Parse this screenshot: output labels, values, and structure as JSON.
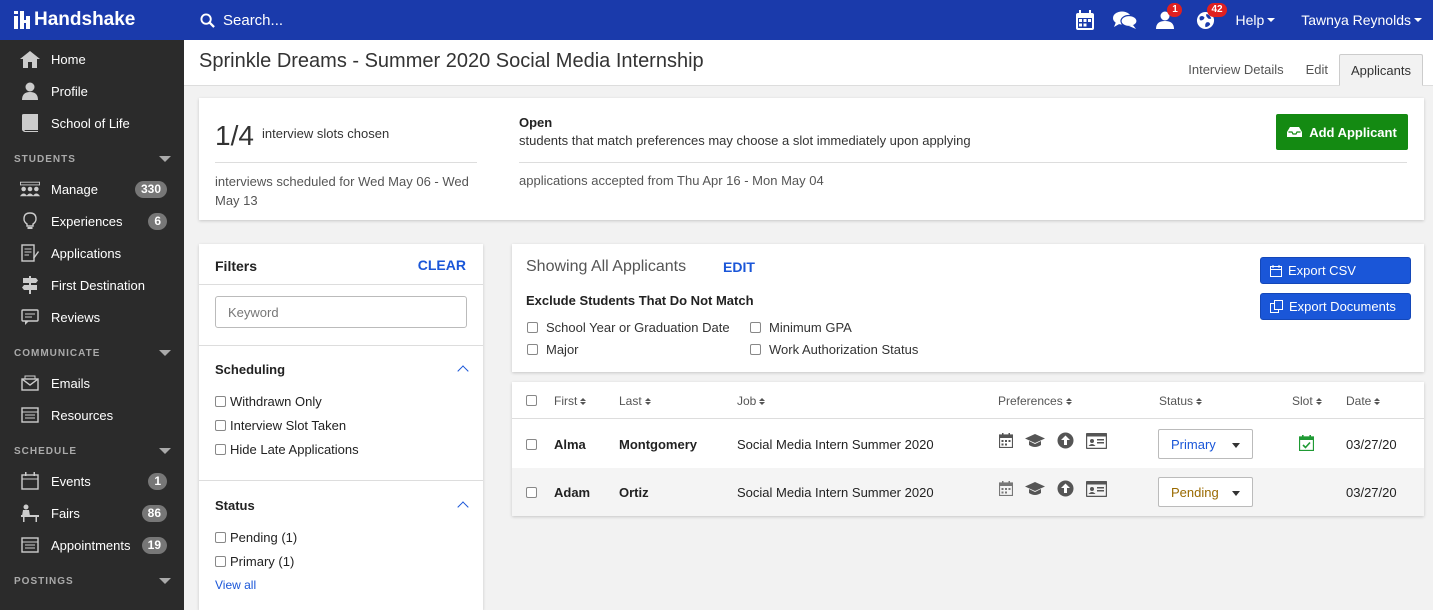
{
  "topbar": {
    "brand": "Handshake",
    "search_label": "Search...",
    "notif_badge": "1",
    "globe_badge": "42",
    "help_label": "Help",
    "user_name": "Tawnya Reynolds",
    "colors": {
      "bar": "#1a3aab",
      "badge": "#e02020"
    }
  },
  "sidebar": {
    "top_items": [
      {
        "label": "Home",
        "icon": "home-icon"
      },
      {
        "label": "Profile",
        "icon": "profile-icon"
      },
      {
        "label": "School of Life",
        "icon": "book-icon"
      }
    ],
    "students_section": "STUDENTS",
    "students_items": [
      {
        "label": "Manage",
        "count": "330",
        "icon": "manage-icon"
      },
      {
        "label": "Experiences",
        "count": "6",
        "icon": "lightbulb-icon"
      },
      {
        "label": "Applications",
        "icon": "applications-icon"
      },
      {
        "label": "First Destination",
        "icon": "signpost-icon"
      },
      {
        "label": "Reviews",
        "icon": "reviews-icon"
      }
    ],
    "communicate_section": "COMMUNICATE",
    "communicate_items": [
      {
        "label": "Emails",
        "icon": "email-icon"
      },
      {
        "label": "Resources",
        "icon": "resources-icon"
      }
    ],
    "schedule_section": "SCHEDULE",
    "schedule_items": [
      {
        "label": "Events",
        "count": "1",
        "icon": "calendar-icon"
      },
      {
        "label": "Fairs",
        "count": "86",
        "icon": "fairs-icon"
      },
      {
        "label": "Appointments",
        "count": "19",
        "icon": "appointments-icon"
      }
    ],
    "postings_section": "POSTINGS"
  },
  "page": {
    "title": "Sprinkle Dreams - Summer 2020 Social Media Internship",
    "tabs": [
      {
        "label": "Interview Details"
      },
      {
        "label": "Edit"
      },
      {
        "label": "Applicants",
        "active": true
      }
    ]
  },
  "summary": {
    "slots_count": "1/4",
    "slots_label": "interview slots chosen",
    "scheduled_text": "interviews scheduled for Wed May 06 - Wed May 13",
    "open_title": "Open",
    "open_desc": "students that match preferences may choose a slot immediately upon applying",
    "applications_text": "applications accepted from Thu Apr 16 - Mon May 04",
    "add_button": "Add Applicant",
    "add_color": "#148a12"
  },
  "filters": {
    "title": "Filters",
    "clear": "CLEAR",
    "keyword_placeholder": "Keyword",
    "scheduling_title": "Scheduling",
    "scheduling_options": [
      "Withdrawn Only",
      "Interview Slot Taken",
      "Hide Late Applications"
    ],
    "status_title": "Status",
    "status_options": [
      "Pending (1)",
      "Primary (1)"
    ],
    "view_all": "View all"
  },
  "applicants": {
    "showing": "Showing All Applicants",
    "edit": "EDIT",
    "exclude_title": "Exclude Students That Do Not Match",
    "exclude_options": [
      "School Year or Graduation Date",
      "Minimum GPA",
      "Major",
      "Work Authorization Status"
    ],
    "export_csv": "Export CSV",
    "export_docs": "Export Documents",
    "accent": "#1a56d8"
  },
  "table": {
    "headers": [
      "First",
      "Last",
      "Job",
      "Preferences",
      "Status",
      "Slot",
      "Date"
    ],
    "rows": [
      {
        "first": "Alma",
        "last": "Montgomery",
        "job": "Social Media Intern Summer 2020",
        "status": "Primary",
        "status_color": "#1a56d8",
        "has_slot": true,
        "date": "03/27/20"
      },
      {
        "first": "Adam",
        "last": "Ortiz",
        "job": "Social Media Intern Summer 2020",
        "status": "Pending",
        "status_color": "#9a6a00",
        "has_slot": false,
        "date": "03/27/20"
      }
    ]
  }
}
